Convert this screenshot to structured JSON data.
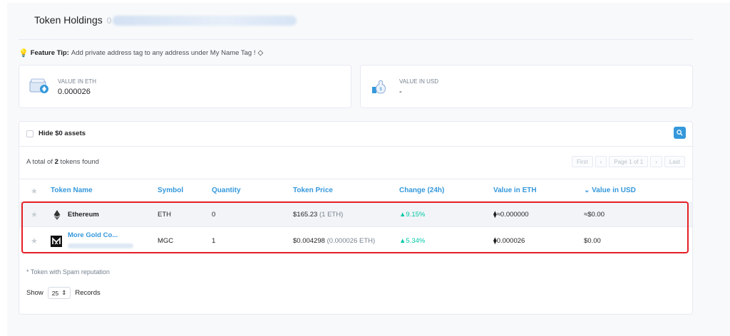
{
  "header": {
    "title": "Token Holdings",
    "address_prefix": "0"
  },
  "tip": {
    "label": "Feature Tip:",
    "text": "Add private address tag to any address under My Name Tag !",
    "tip_icon": "lightbulb-icon",
    "tag_icon": "tag-icon"
  },
  "value_cards": {
    "eth": {
      "label": "VALUE IN ETH",
      "value": "0.000026",
      "icon": "wallet-icon"
    },
    "usd": {
      "label": "VALUE IN USD",
      "value": "-",
      "icon": "money-bag-icon"
    }
  },
  "filter": {
    "hide_zero_label": "Hide $0 assets",
    "search_icon": "search-icon"
  },
  "summary": {
    "prefix": "A total of ",
    "count": "2",
    "suffix": " tokens found"
  },
  "pagination": {
    "first": "First",
    "prev": "‹",
    "page": "Page 1 of 1",
    "next": "›",
    "last": "Last"
  },
  "table": {
    "columns": {
      "name": "Token Name",
      "symbol": "Symbol",
      "quantity": "Quantity",
      "price": "Token Price",
      "change": "Change (24h)",
      "value_eth": "Value in ETH",
      "value_usd": "Value in USD"
    },
    "sort_indicator": "⌄",
    "rows": [
      {
        "name": "Ethereum",
        "symbol": "ETH",
        "quantity": "0",
        "price": "$165.23",
        "price_eth": "(1 ETH)",
        "change": "▲9.15%",
        "value_eth": "⧫≈0.000000",
        "value_usd": "≈$0.00",
        "icon": "ethereum-icon"
      },
      {
        "name": "More Gold Co...",
        "symbol": "MGC",
        "quantity": "1",
        "price": "$0.004298",
        "price_eth": "(0.000026 ETH)",
        "change": "▲5.34%",
        "value_eth": "⧫0.000026",
        "value_usd": "$0.00",
        "icon": "mgc-logo-icon"
      }
    ]
  },
  "footer": {
    "spam_note": "* Token with Spam reputation",
    "show_label": "Show",
    "page_size": "25",
    "records_label": "Records"
  },
  "colors": {
    "accent": "#3498db",
    "positive": "#00c9a7",
    "highlight": "#e41f26"
  }
}
